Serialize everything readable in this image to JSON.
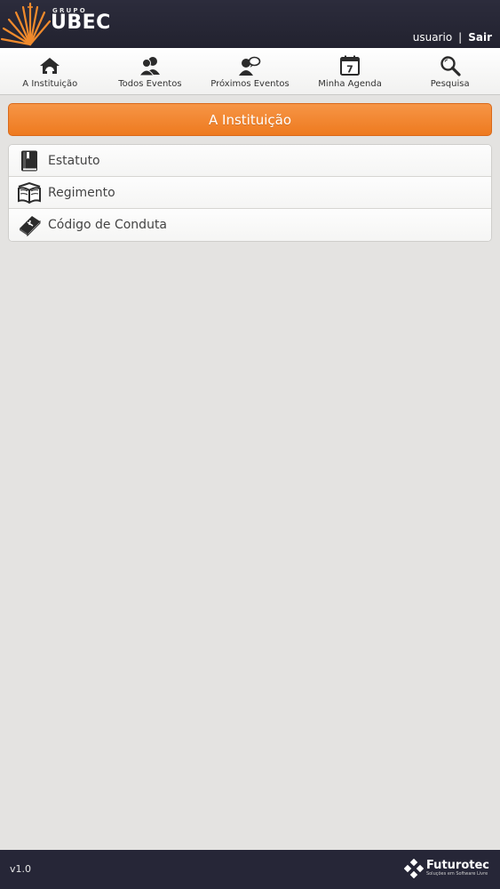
{
  "header": {
    "logo_small": "GRUPO",
    "logo_big": "UBEC",
    "username": "usuario",
    "separator": "|",
    "logout_label": "Sair"
  },
  "nav": {
    "items": [
      {
        "label": "A Instituição",
        "icon": "house-icon"
      },
      {
        "label": "Todos Eventos",
        "icon": "users-icon"
      },
      {
        "label": "Próximos Eventos",
        "icon": "user-chat-icon"
      },
      {
        "label": "Minha Agenda",
        "icon": "calendar-icon",
        "day": "7"
      },
      {
        "label": "Pesquisa",
        "icon": "search-icon"
      }
    ]
  },
  "page": {
    "title": "A Instituição"
  },
  "list": {
    "items": [
      {
        "label": "Estatuto",
        "icon": "closed-book-icon"
      },
      {
        "label": "Regimento",
        "icon": "open-book-icon"
      },
      {
        "label": "Código de Conduta",
        "icon": "bible-icon"
      }
    ]
  },
  "footer": {
    "version": "v1.0",
    "brand_name": "Futurotec",
    "brand_tagline": "Soluções em Software Livre"
  },
  "colors": {
    "header_bg": "#262637",
    "accent": "#f08226",
    "body_bg": "#e4e3e1"
  }
}
